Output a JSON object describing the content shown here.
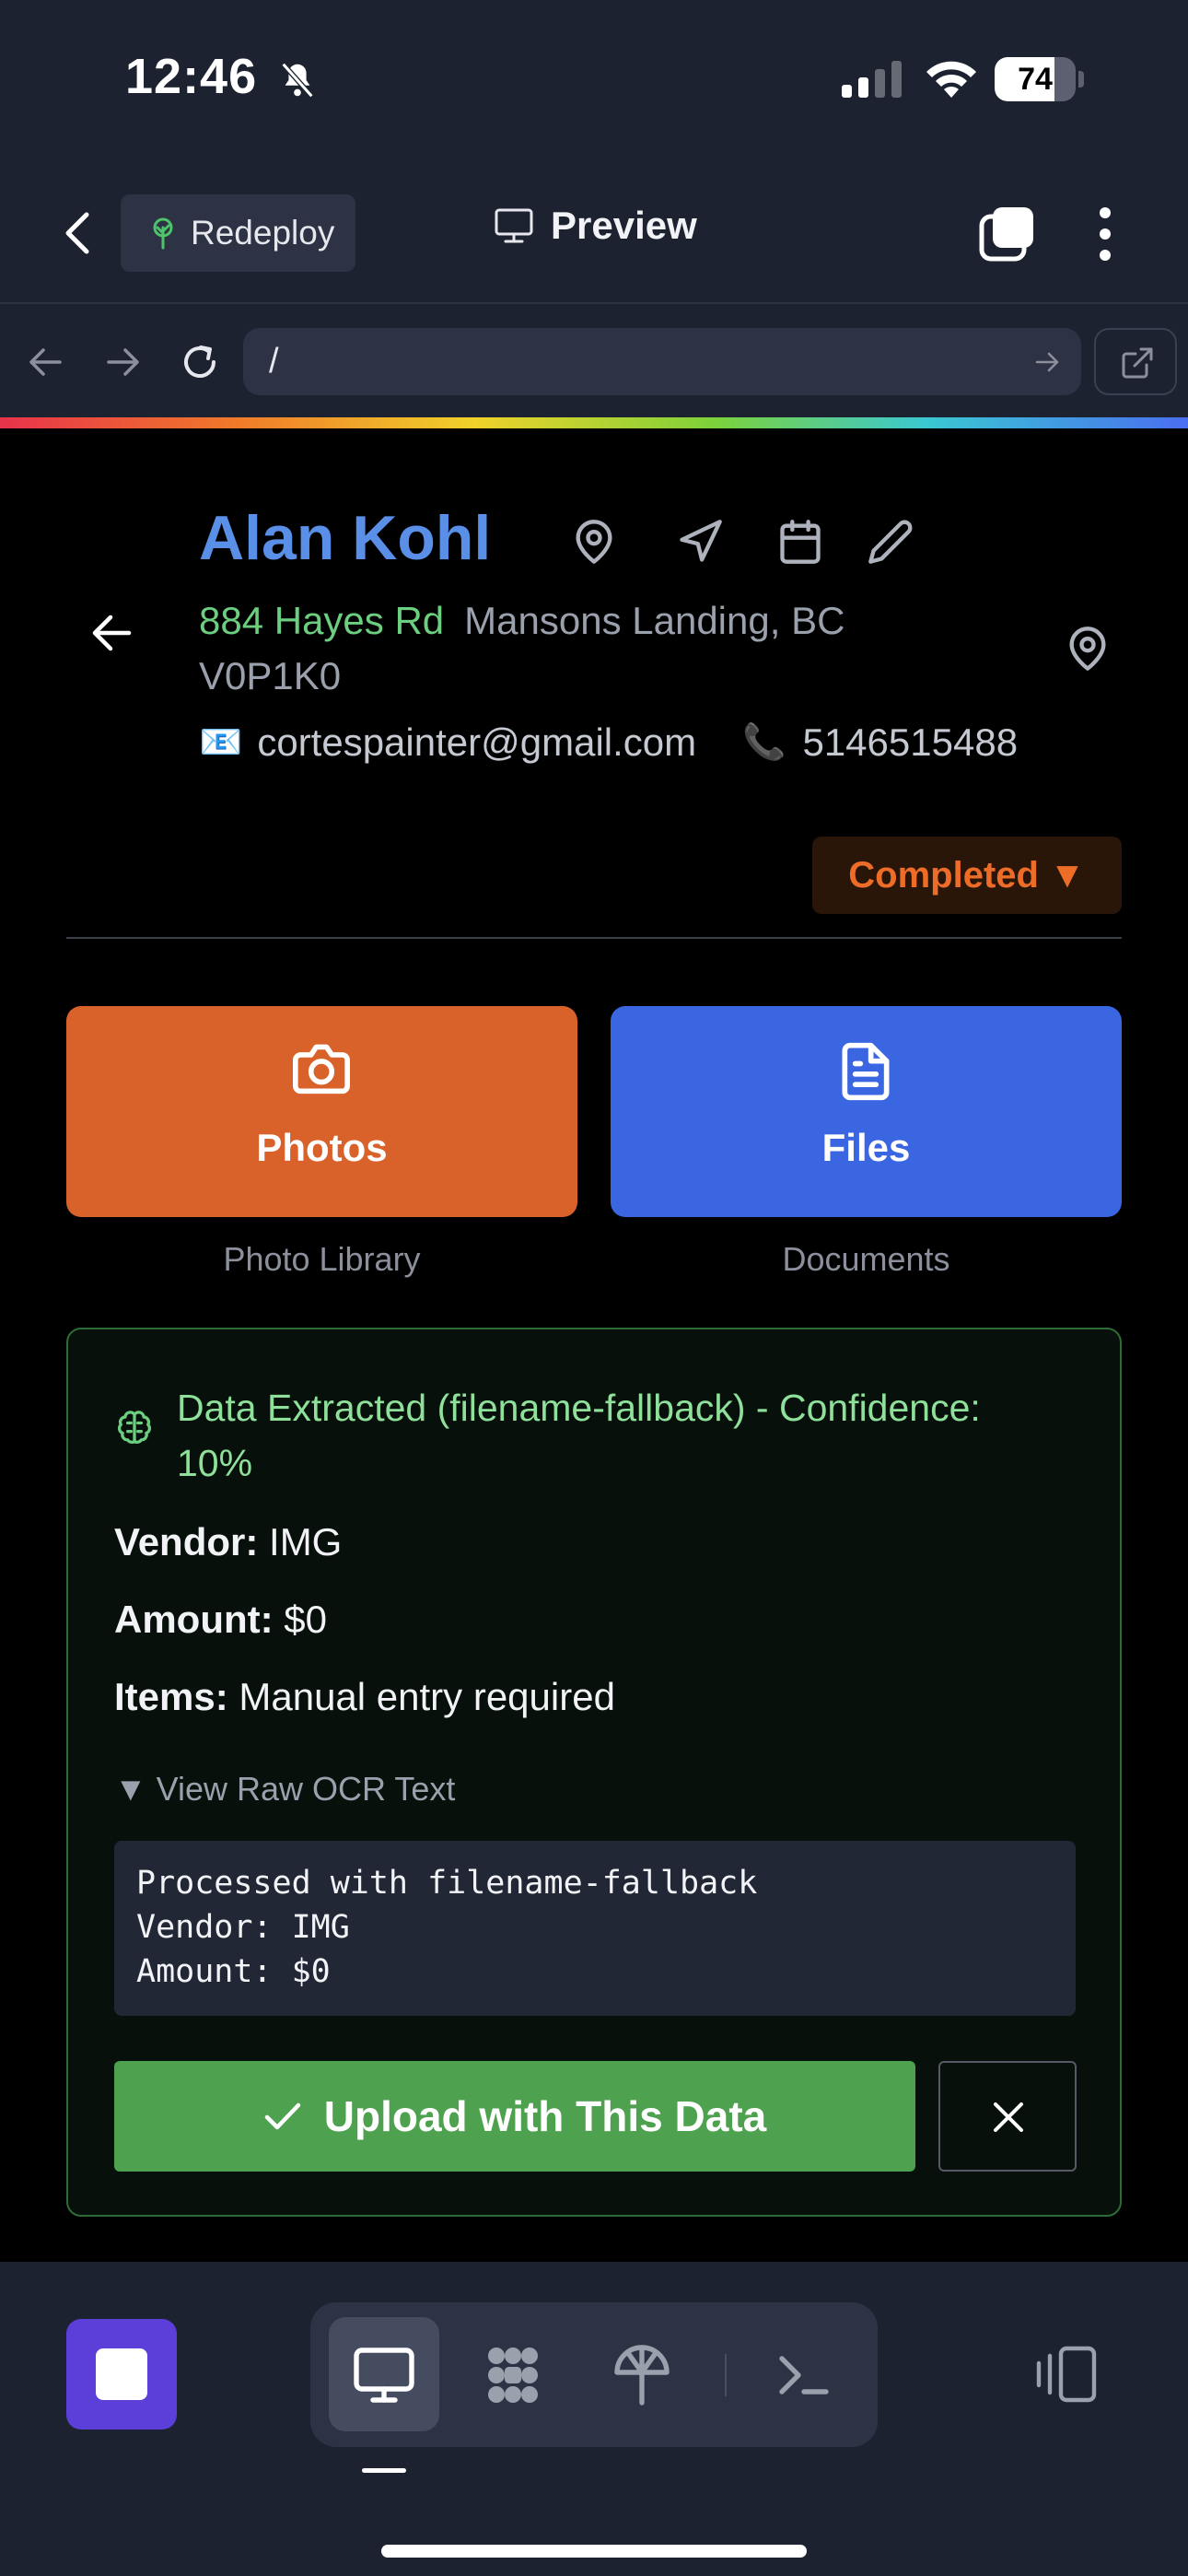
{
  "status_bar": {
    "time": "12:46",
    "battery": "74",
    "battery_level": 0.74
  },
  "toolbar": {
    "redeploy_label": "Redeploy",
    "preview_label": "Preview"
  },
  "url_bar": {
    "url": "/"
  },
  "customer": {
    "name": "Alan Kohl",
    "street": "884 Hayes Rd",
    "city": "Mansons Landing, BC",
    "postal": "V0P1K0",
    "email_emoji": "📧",
    "email": "cortespainter@gmail.com",
    "phone_emoji": "📞",
    "phone": "5146515488",
    "status": "Completed ▼"
  },
  "actions": {
    "photos": {
      "label": "Photos",
      "sub": "Photo Library"
    },
    "files": {
      "label": "Files",
      "sub": "Documents"
    }
  },
  "extraction": {
    "title": "Data Extracted (filename-fallback) - Confidence: 10%",
    "vendor_label": "Vendor:",
    "vendor": "IMG",
    "amount_label": "Amount:",
    "amount": "$0",
    "items_label": "Items:",
    "items": "Manual entry required",
    "raw_toggle": "▼ View Raw OCR Text",
    "raw_text": "Processed with filename-fallback\nVendor: IMG\nAmount: $0",
    "upload_label": "Upload with This Data"
  },
  "colors": {
    "accent_name": "#5a8fe8",
    "street": "#6ccf7f",
    "status": "#ec6c28",
    "photos_tile": "#d9622b",
    "files_tile": "#3a66e2",
    "upload_button": "#4ea24f",
    "stop_button": "#5b3fd8"
  },
  "icons": {
    "header": [
      "map-pin-icon",
      "navigation-icon",
      "calendar-icon",
      "edit-icon"
    ],
    "bottom_segments": [
      "desktop-icon",
      "apps-icon",
      "deploy-icon",
      "terminal-icon"
    ]
  }
}
